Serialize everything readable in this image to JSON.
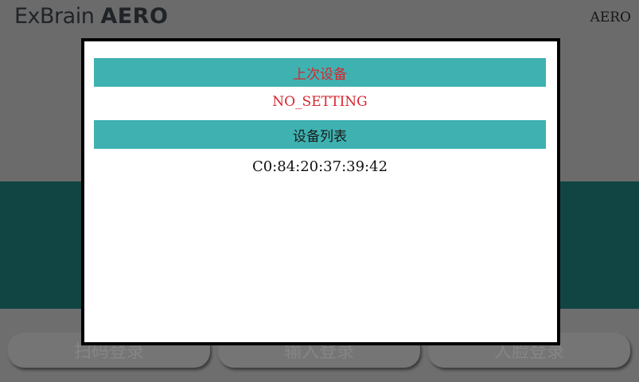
{
  "header": {
    "logo_light": "ExBrain",
    "logo_bold": "AERO",
    "model_label": "AERO"
  },
  "actions": {
    "scan_login": "扫码登录",
    "input_login": "输入登录",
    "face_login": "人脸登录"
  },
  "dialog": {
    "last_device_title": "上次设备",
    "last_device_value": "NO_SETTING",
    "device_list_title": "设备列表",
    "devices": [
      {
        "address": "C0:84:20:37:39:42"
      }
    ]
  },
  "colors": {
    "header_bar": "#3fb1b1",
    "alert_red": "#d8252e",
    "teal_band": "#1f7e7b",
    "dialog_border": "#000000"
  }
}
